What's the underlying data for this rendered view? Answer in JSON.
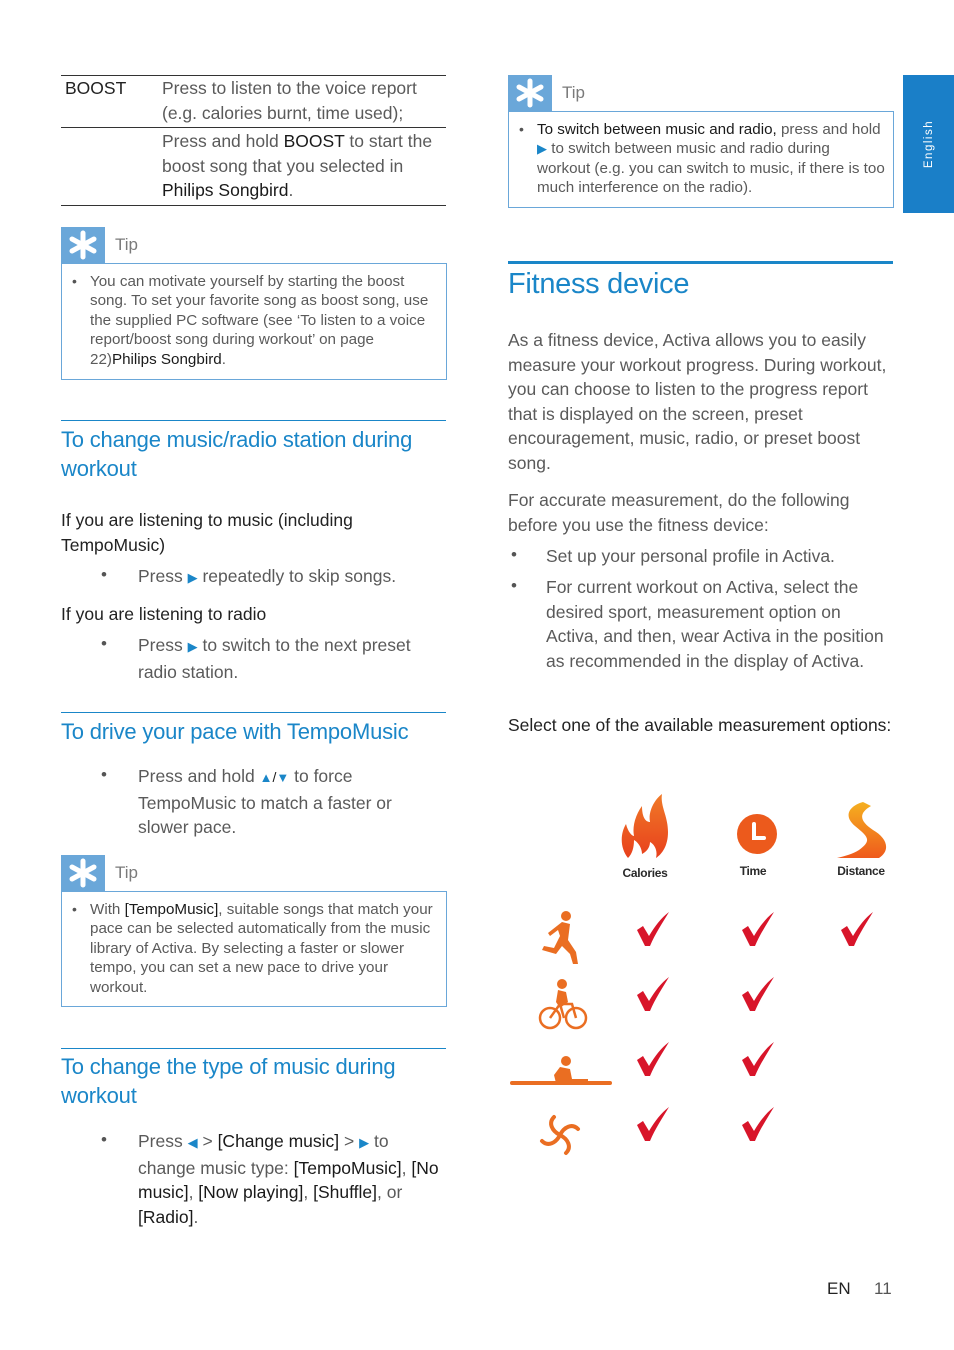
{
  "side_tab": {
    "language": "English"
  },
  "boost_table": {
    "key": "BOOST",
    "row1": "Press to listen to the voice report (e.g. calories burnt, time used);",
    "row2_pre": "Press and hold ",
    "row2_bold": "BOOST",
    "row2_mid": " to start the boost song that you selected in ",
    "row2_app": "Philips Songbird",
    "row2_end": "."
  },
  "tip1": {
    "label": "Tip",
    "text": "You can motivate yourself by starting the boost song. To set your favorite song as boost song, use the supplied PC software (see ‘To listen to a voice report/boost song during workout’ on page 22)",
    "bold": "Philips Songbird",
    "end": "."
  },
  "section_change_station": {
    "title": "To change music/radio station during workout",
    "music_intro": "If you are listening to music (including TempoMusic)",
    "music_bullet_pre": "Press ",
    "music_bullet_post": " repeatedly to skip songs.",
    "radio_intro": "If you are listening to radio",
    "radio_bullet_pre": "Press ",
    "radio_bullet_post": " to switch to the next preset radio station."
  },
  "section_tempo": {
    "title": "To drive your pace with TempoMusic",
    "bullet_pre": "Press and hold ",
    "bullet_post": " to force TempoMusic to match a faster or slower pace."
  },
  "tip2": {
    "label": "Tip",
    "pre": "With ",
    "bold": "[TempoMusic]",
    "text": ", suitable songs that match your pace can be selected automatically from the music library of Activa. By selecting a faster or slower tempo, you can set a new pace to drive your workout."
  },
  "section_type": {
    "title": "To change the type of music during workout",
    "press": "Press ",
    "gt": " > ",
    "change_music": "[Change music]",
    "to": " to change music type: ",
    "opt1": "[TempoMusic]",
    "opt2": "[No music]",
    "opt3": "[Now playing]",
    "opt4": "[Shuffle]",
    "opt5": "[Radio]",
    "comma": ", ",
    "or": "or ",
    "end": "."
  },
  "tip3": {
    "label": "Tip",
    "bold": "To switch between music and radio,",
    "pre": " press and hold ",
    "text": " to switch between music and radio during workout (e.g. you can switch to music, if there is too much interference on the radio)."
  },
  "fitness": {
    "title": "Fitness device",
    "para1": "As a fitness device, Activa allows you to easily measure your workout progress. During workout, you can choose to listen to the progress report that is displayed on the screen, preset encouragement, music, radio, or preset boost song.",
    "para2": "For accurate measurement, do the following before you use the fitness device:",
    "bullets": [
      "Set up your personal profile in Activa.",
      "For current workout on Activa, select the desired sport, measurement option on Activa, and then, wear Activa in the position as recommended in the display of Activa."
    ],
    "select_text": "Select one of the available measurement options:",
    "grid": {
      "columns": [
        "Calories",
        "Time",
        "Distance"
      ],
      "rows": [
        {
          "sport": "running",
          "checks": [
            true,
            true,
            true
          ]
        },
        {
          "sport": "cycling",
          "checks": [
            true,
            true,
            false
          ]
        },
        {
          "sport": "rowing",
          "checks": [
            true,
            true,
            false
          ]
        },
        {
          "sport": "other",
          "checks": [
            true,
            true,
            false
          ]
        }
      ]
    }
  },
  "footer": {
    "lang": "EN",
    "page": "11"
  }
}
